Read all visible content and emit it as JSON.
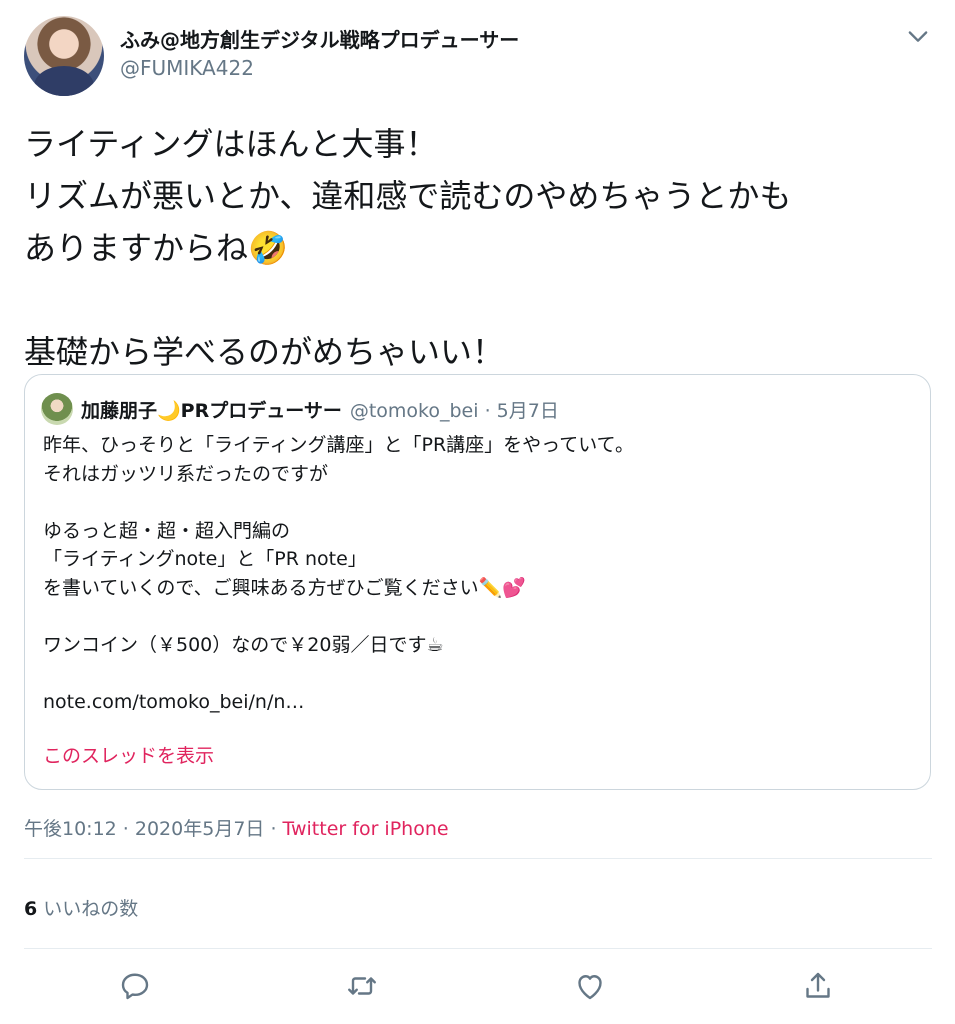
{
  "author": {
    "display_name": "ふみ@地方創生デジタル戦略プロデューサー",
    "handle": "@FUMIKA422"
  },
  "tweet_text": "ライティングはほんと大事！\nリズムが悪いとか、違和感で読むのやめちゃうとかも\nありますからね🤣\n\n基礎から学べるのがめちゃいい！",
  "quote": {
    "display_name": "加藤朋子🌙PRプロデューサー",
    "handle_date": "@tomoko_bei · 5月7日",
    "text": "昨年、ひっそりと「ライティング講座」と「PR講座」をやっていて。\nそれはガッツリ系だったのですが\n\nゆるっと超・超・超入門編の\n「ライティングnote」と「PR note」\nを書いていくので、ご興味ある方ぜひご覧ください✏️💕\n\nワンコイン（￥500）なので￥20弱／日です☕\n\nnote.com/tomoko_bei/n/n…",
    "thread_link": "このスレッドを表示"
  },
  "meta": {
    "timestamp": "午後10:12 · 2020年5月7日 · ",
    "source": "Twitter for iPhone"
  },
  "likes": {
    "count": "6",
    "label": "いいねの数"
  },
  "icons": {
    "menu": "chevron-down-icon",
    "reply": "reply-icon",
    "retweet": "retweet-icon",
    "like": "like-icon",
    "share": "share-icon"
  },
  "colors": {
    "accent": "#e0245e",
    "secondary_text": "#657786",
    "border": "#ccd6dd"
  }
}
